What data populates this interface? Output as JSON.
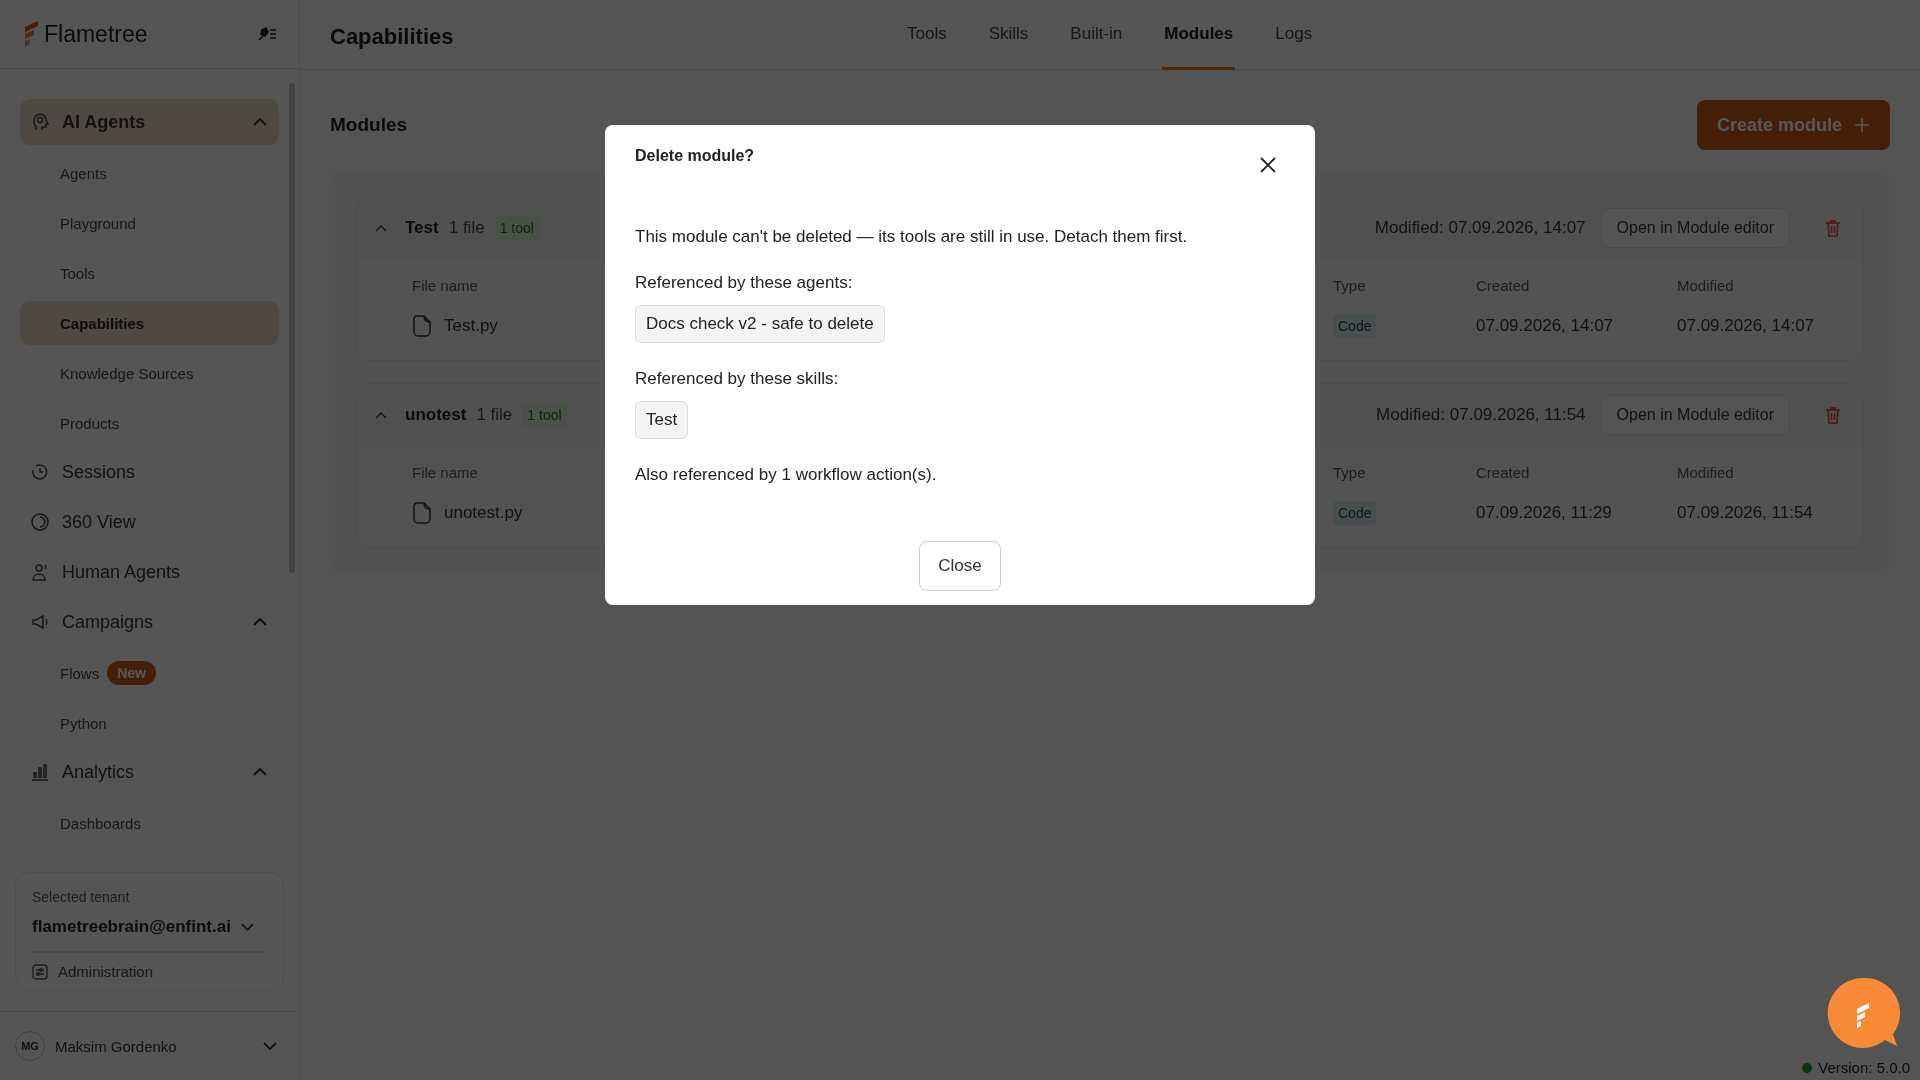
{
  "brand": {
    "name": "Flametree"
  },
  "sidebar": {
    "items": [
      {
        "label": "AI Agents",
        "selected": true,
        "expanded": true,
        "children": [
          {
            "label": "Agents",
            "selected": false
          },
          {
            "label": "Playground",
            "selected": false
          },
          {
            "label": "Tools",
            "selected": false
          },
          {
            "label": "Capabilities",
            "selected": true
          },
          {
            "label": "Knowledge Sources",
            "selected": false
          },
          {
            "label": "Products",
            "selected": false
          }
        ]
      },
      {
        "label": "Sessions",
        "selected": false
      },
      {
        "label": "360 View",
        "selected": false
      },
      {
        "label": "Human Agents",
        "selected": false
      },
      {
        "label": "Campaigns",
        "selected": false,
        "expanded": true,
        "children": [
          {
            "label": "Flows",
            "selected": false,
            "badge": "New"
          },
          {
            "label": "Python",
            "selected": false
          }
        ]
      },
      {
        "label": "Analytics",
        "selected": false,
        "expanded": true,
        "children": [
          {
            "label": "Dashboards",
            "selected": false
          }
        ]
      }
    ],
    "tenant": {
      "label": "Selected tenant",
      "value": "flametreebrain@enfint.ai",
      "link": "Administration"
    },
    "user": {
      "initials": "MG",
      "name": "Maksim Gordenko"
    }
  },
  "header": {
    "title": "Capabilities",
    "tabs": [
      {
        "label": "Tools",
        "selected": false
      },
      {
        "label": "Skills",
        "selected": false
      },
      {
        "label": "Built-in",
        "selected": false
      },
      {
        "label": "Modules",
        "selected": true
      },
      {
        "label": "Logs",
        "selected": false
      }
    ]
  },
  "section": {
    "title": "Modules",
    "create_button": "Create module"
  },
  "modules": [
    {
      "name": "Test",
      "files": "1 file",
      "tools": "1 tool",
      "expanded": true,
      "modified": "Modified: 07.09.2026, 14:07",
      "open_button": "Open in Module editor",
      "columns": [
        "File name",
        "Type",
        "Created",
        "Modified"
      ],
      "rows": [
        {
          "file": "Test.py",
          "type": "Code",
          "created": "07.09.2026, 14:07",
          "modified": "07.09.2026, 14:07"
        }
      ]
    },
    {
      "name": "unotest",
      "files": "1 file",
      "tools": "1 tool",
      "expanded": true,
      "modified": "Modified: 07.09.2026, 11:54",
      "open_button": "Open in Module editor",
      "columns": [
        "File name",
        "Type",
        "Created",
        "Modified"
      ],
      "rows": [
        {
          "file": "unotest.py",
          "type": "Code",
          "created": "07.09.2026, 11:29",
          "modified": "07.09.2026, 11:54"
        }
      ]
    }
  ],
  "dialog": {
    "title": "Delete module?",
    "message": "This module can't be deleted — its tools are still in use. Detach them first.",
    "agents_label": "Referenced by these agents:",
    "agents": [
      "Docs check v2 - safe to delete"
    ],
    "skills_label": "Referenced by these skills:",
    "skills": [
      "Test"
    ],
    "note": "Also referenced by 1 workflow action(s).",
    "close_button": "Close"
  },
  "version": "Version: 5.0.0"
}
